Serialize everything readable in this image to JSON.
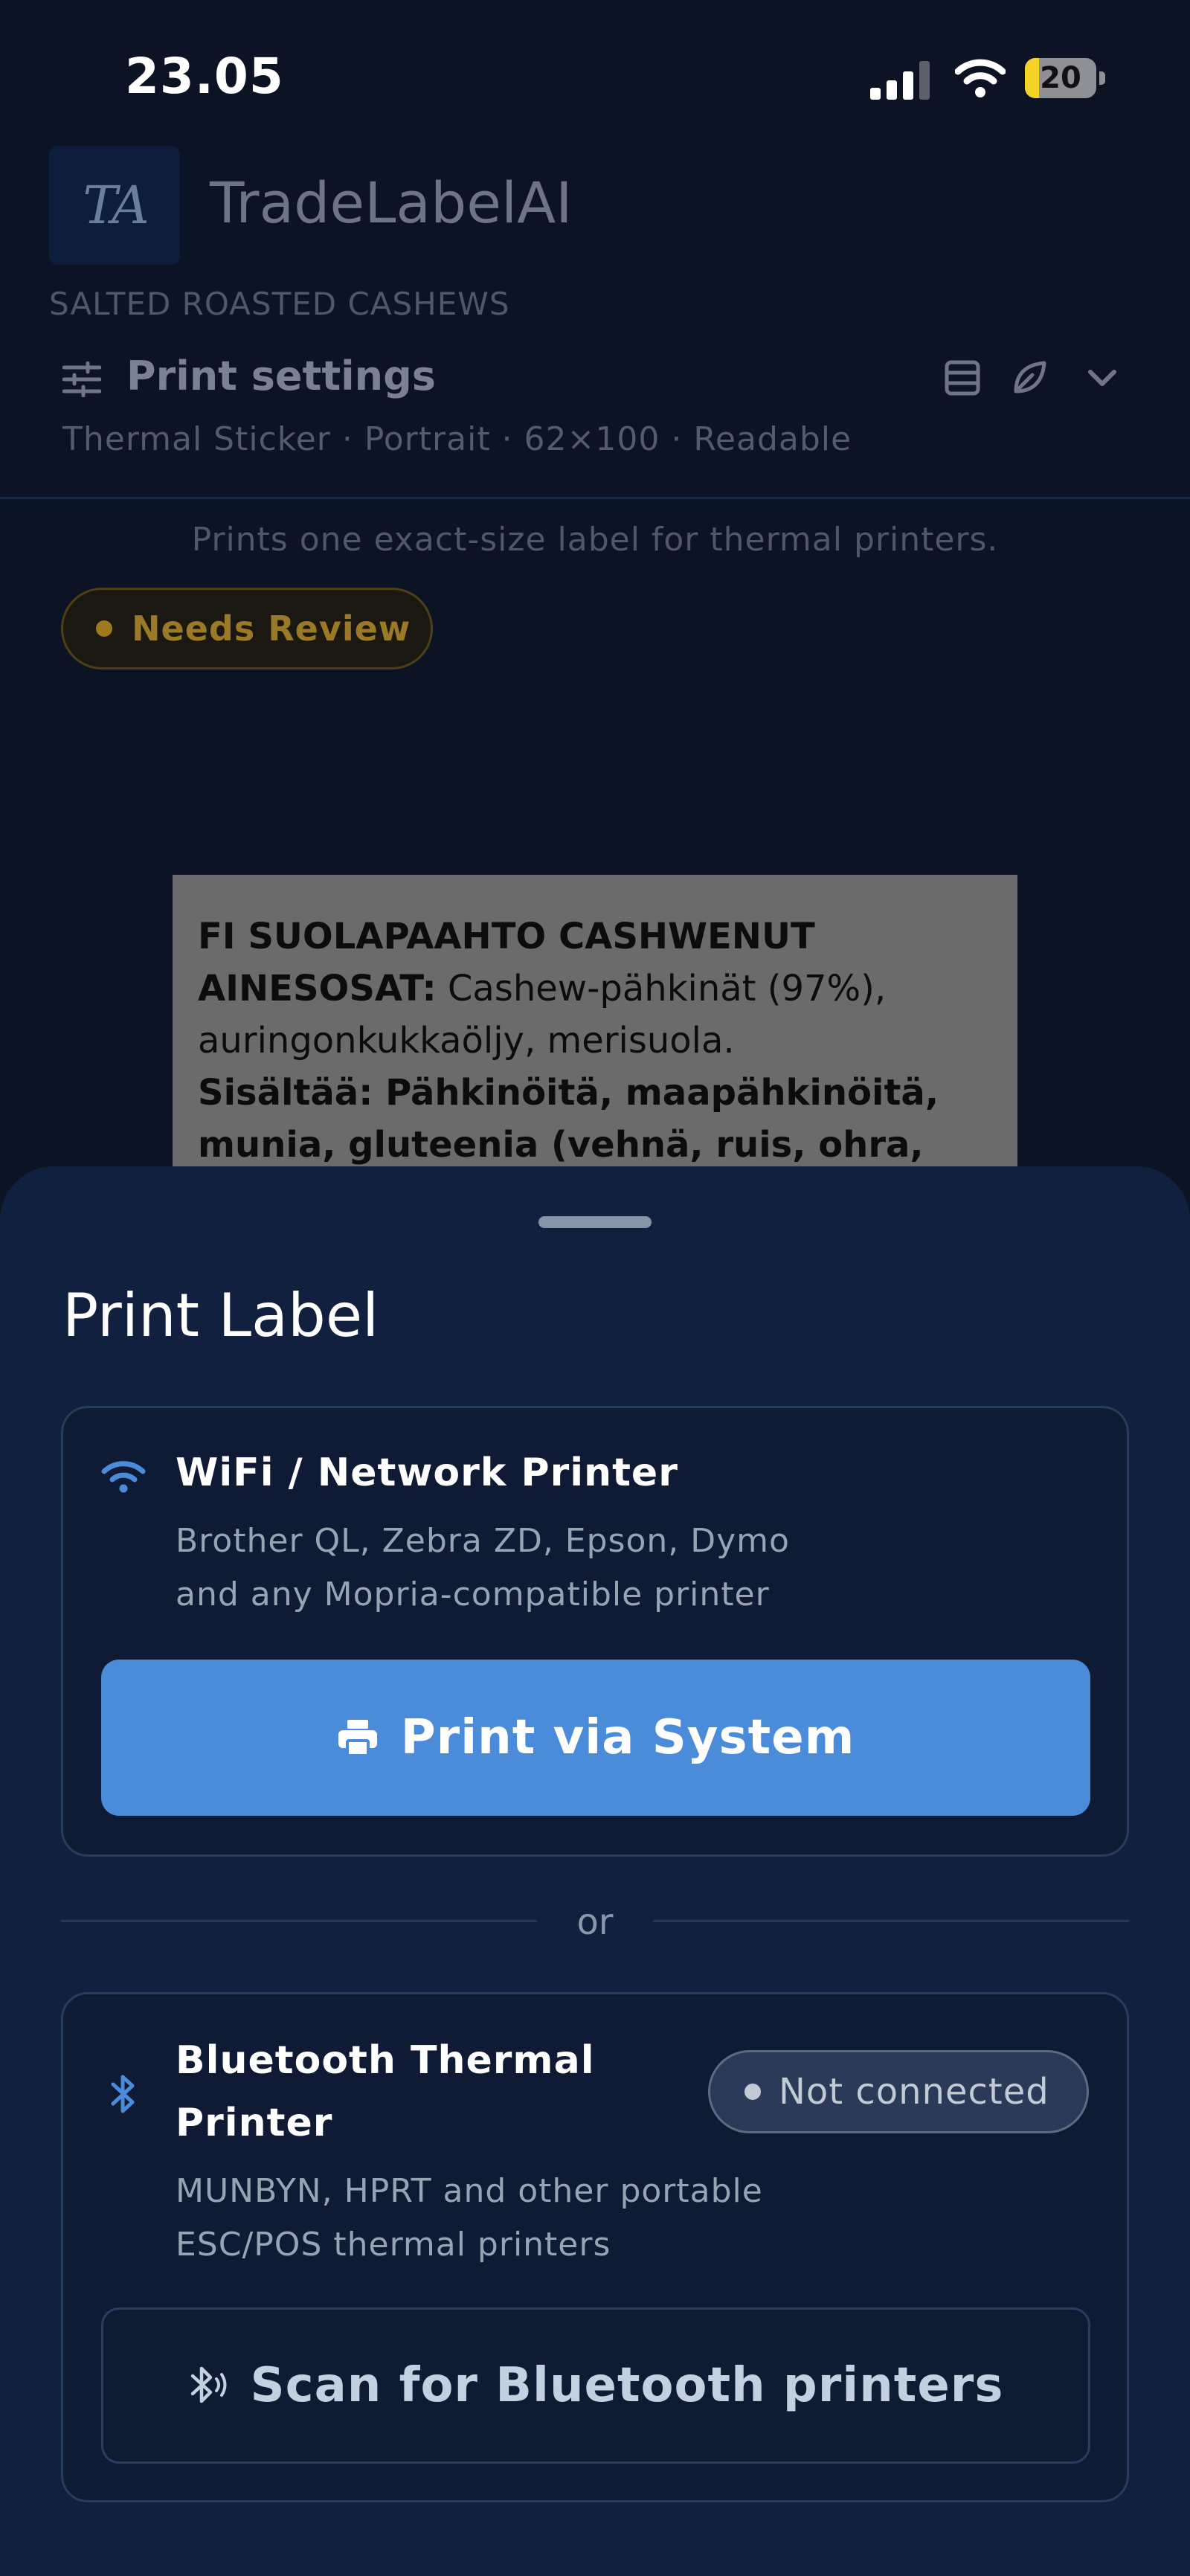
{
  "status_bar": {
    "time": "23.05",
    "battery": "20",
    "battery_level": 0.2,
    "icons": [
      "signal-icon",
      "wifi-icon",
      "battery-charging-icon"
    ]
  },
  "header": {
    "logo_text": "TA",
    "app_title": "TradeLabelAI",
    "product_name": "SALTED ROASTED CASHEWS",
    "settings_title": "Print settings",
    "settings_summary": "Thermal Sticker · Portrait · 62×100 · Readable",
    "icons": [
      "sliders-icon",
      "table-icon",
      "leaf-icon",
      "chevron-down-icon"
    ]
  },
  "main": {
    "prints_note": "Prints one exact-size label for thermal printers.",
    "review_badge": "Needs Review",
    "review_color": "#9a7a26",
    "label_preview": {
      "line1_bold": "FI SUOLAPAAHTO CASHWENUT",
      "line2_bold": "AINESOSAT:",
      "line2_rest": " Cashew-pähkinät (97%),",
      "line3": "auringonkukkaöljy, merisuola.",
      "line4_bold": "Sisältää: Pähkinöitä, maapähkinöitä,",
      "line5_bold": "munia, gluteenia (vehnä, ruis, ohra,"
    }
  },
  "sheet": {
    "title": "Print Label",
    "wifi_option": {
      "title": "WiFi / Network Printer",
      "desc_line1": "Brother QL, Zebra ZD, Epson, Dymo",
      "desc_line2": "and any Mopria-compatible printer",
      "button_label": "Print via System"
    },
    "or_label": "or",
    "bt_option": {
      "title_line1": "Bluetooth Thermal",
      "title_line2": "Printer",
      "status": "Not connected",
      "desc_line1": "MUNBYN, HPRT and other portable",
      "desc_line2": "ESC/POS thermal printers",
      "button_label": "Scan for Bluetooth printers"
    },
    "accent_color": "#4a8cd9"
  }
}
